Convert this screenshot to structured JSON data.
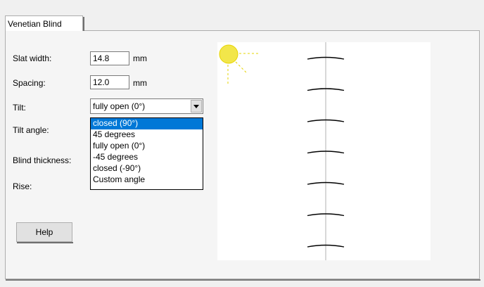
{
  "tab": {
    "label": "Venetian Blind"
  },
  "fields": {
    "slat_width": {
      "label": "Slat width:",
      "value": "14.8",
      "unit": "mm"
    },
    "spacing": {
      "label": "Spacing:",
      "value": "12.0",
      "unit": "mm"
    },
    "tilt": {
      "label": "Tilt:",
      "selected": "fully open (0°)"
    },
    "tilt_angle": {
      "label": "Tilt angle:"
    },
    "blind_thickness": {
      "label": "Blind thickness:"
    },
    "rise": {
      "label": "Rise:"
    }
  },
  "tilt_options": [
    "closed (90°)",
    "45 degrees",
    "fully open (0°)",
    "-45 degrees",
    "closed (-90°)",
    "Custom angle"
  ],
  "tilt_highlighted": "closed (90°)",
  "help_button": {
    "label": "Help"
  },
  "preview": {
    "sun_color": "#f2e64a",
    "slat_count": 7
  }
}
